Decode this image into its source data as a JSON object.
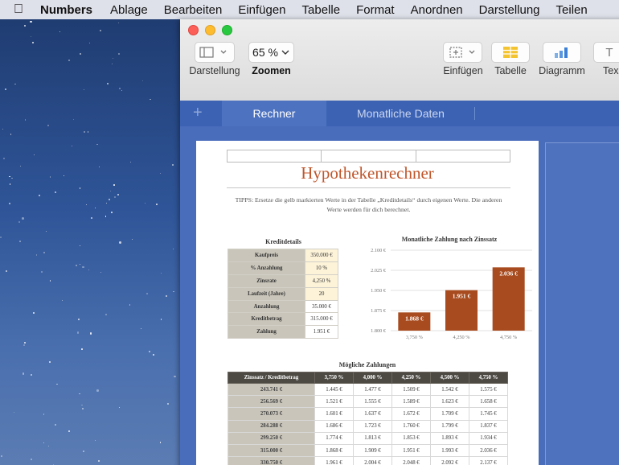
{
  "menubar": {
    "app_name": "Numbers",
    "items": [
      "Ablage",
      "Bearbeiten",
      "Einfügen",
      "Tabelle",
      "Format",
      "Anordnen",
      "Darstellung",
      "Teilen"
    ]
  },
  "toolbar": {
    "darstellung_label": "Darstellung",
    "zoom_value": "65 %",
    "zoom_label": "Zoomen",
    "einfuegen_label": "Einfügen",
    "tabelle_label": "Tabelle",
    "diagramm_label": "Diagramm",
    "text_label": "Tex"
  },
  "sheets": {
    "plus": "+",
    "tabs": [
      "Rechner",
      "Monatliche Daten"
    ]
  },
  "document": {
    "title": "Hypothekenrechner",
    "tipps": "TIPPS: Ersetze die gelb markierten Werte in der Tabelle „Kreditdetails“ durch eigenen Werte. Die anderen Werte werden für dich berechnet.",
    "kreditdetails": {
      "title": "Kreditdetails",
      "rows": [
        {
          "label": "Kaufpreis",
          "value": "350.000 €"
        },
        {
          "label": "% Anzahlung",
          "value": "10 %"
        },
        {
          "label": "Zinsrate",
          "value": "4,250 %"
        },
        {
          "label": "Laufzeit (Jahre)",
          "value": "20"
        },
        {
          "label": "Anzahlung",
          "value": "35.000 €"
        },
        {
          "label": "Kreditbetrag",
          "value": "315.000 €"
        },
        {
          "label": "Zahlung",
          "value": "1.951 €"
        }
      ]
    },
    "moegliche_zahlungen": {
      "title": "Mögliche Zahlungen",
      "header": [
        "Zinssatz / Kreditbetrag",
        "3,750 %",
        "4,000 %",
        "4,250 %",
        "4,500 %",
        "4,750 %"
      ],
      "rows": [
        [
          "243.741 €",
          "1.445 €",
          "1.477 €",
          "1.509 €",
          "1.542 €",
          "1.575 €"
        ],
        [
          "256.569 €",
          "1.521 €",
          "1.555 €",
          "1.589 €",
          "1.623 €",
          "1.658 €"
        ],
        [
          "270.073 €",
          "1.601 €",
          "1.637 €",
          "1.672 €",
          "1.709 €",
          "1.745 €"
        ],
        [
          "284.288 €",
          "1.686 €",
          "1.723 €",
          "1.760 €",
          "1.799 €",
          "1.837 €"
        ],
        [
          "299.250 €",
          "1.774 €",
          "1.813 €",
          "1.853 €",
          "1.893 €",
          "1.934 €"
        ],
        [
          "315.000 €",
          "1.868 €",
          "1.909 €",
          "1.951 €",
          "1.993 €",
          "2.036 €"
        ],
        [
          "330.750 €",
          "1.961 €",
          "2.004 €",
          "2.048 €",
          "2.092 €",
          "2.137 €"
        ]
      ]
    }
  },
  "chart_data": {
    "type": "bar",
    "title": "Monatliche Zahlung nach Zinssatz",
    "categories": [
      "3,750 %",
      "4,250 %",
      "4,750 %"
    ],
    "values": [
      1868,
      1951,
      2036
    ],
    "data_labels": [
      "1.868 €",
      "1.951 €",
      "2.036 €"
    ],
    "y_ticks": [
      "1.800 €",
      "1.875 €",
      "1.950 €",
      "2.025 €",
      "2.100 €"
    ],
    "ylim": [
      1800,
      2100
    ],
    "bar_color": "#a84b1e",
    "grid": true
  },
  "colors": {
    "title": "#c0562b",
    "sheetbar": "#3c62b4",
    "input_cell": "#fdf3d9",
    "header_fill": "#4d4a44"
  }
}
